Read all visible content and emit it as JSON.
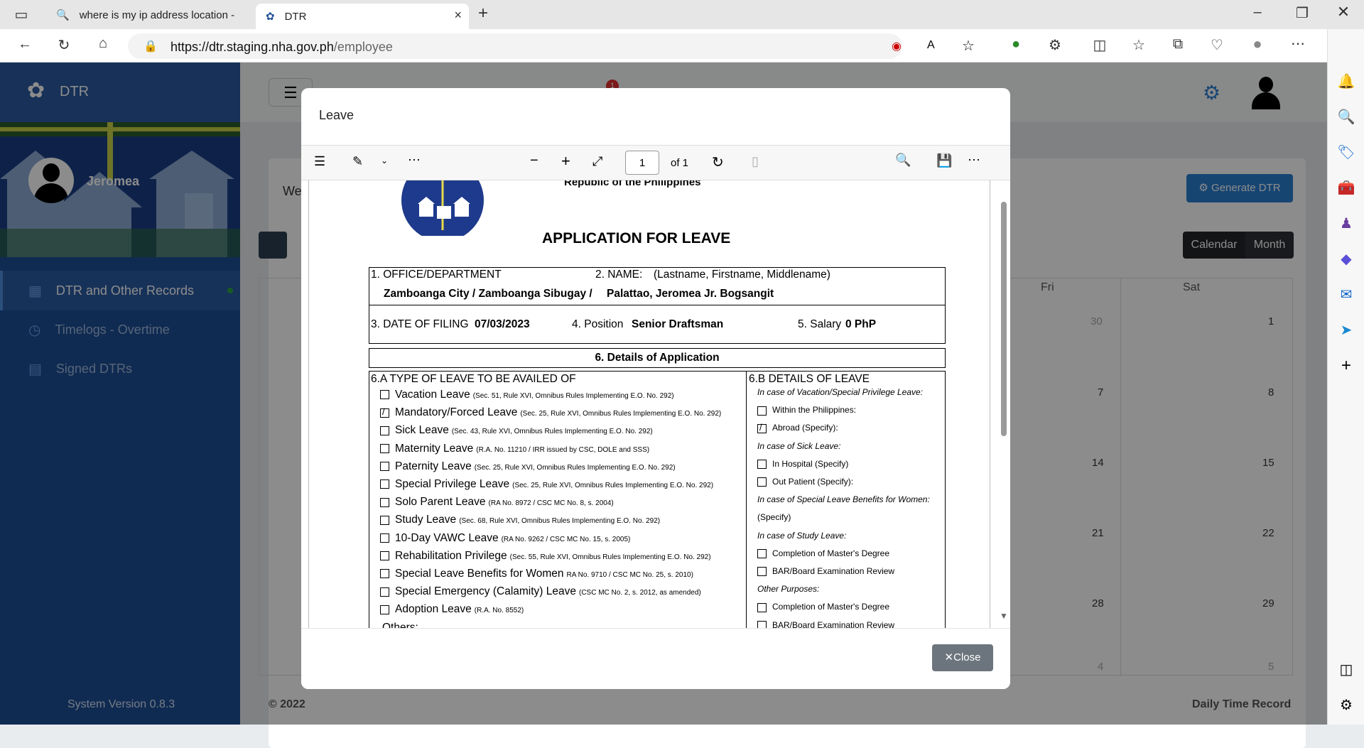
{
  "browser": {
    "tabs": [
      {
        "title": "where is my ip address location -"
      },
      {
        "title": "DTR"
      }
    ],
    "url_host": "https://dtr.staging.nha.gov.ph",
    "url_path": "/employee"
  },
  "app": {
    "brand": "DTR",
    "user_name": "Jeromea",
    "nav": [
      {
        "label": "DTR and Other Records",
        "active": true
      },
      {
        "label": "Timelogs - Overtime",
        "active": false
      },
      {
        "label": "Signed DTRs",
        "active": false
      }
    ],
    "system_version": "System Version 0.8.3",
    "notification_count": "1",
    "card_title_partial": "We",
    "generate_button": "Generate DTR",
    "view_buttons": [
      "Calendar",
      "Month"
    ],
    "weekdays_visible": [
      "Fri",
      "Sat"
    ],
    "calendar_days": [
      {
        "fri": "30",
        "sat": "1"
      },
      {
        "fri": "7",
        "sat": "8"
      },
      {
        "fri": "14",
        "sat": "15"
      },
      {
        "fri": "21",
        "sat": "22"
      },
      {
        "fri": "28",
        "sat": "29"
      },
      {
        "fri": "4",
        "sat": "5"
      }
    ],
    "footer_left": "© 2022",
    "footer_right": "Daily Time Record"
  },
  "modal": {
    "title": "Leave",
    "close_label": "Close",
    "pdf_toolbar": {
      "page": "1",
      "page_total": "of 1"
    },
    "form": {
      "republic": "Republic of the Philippines",
      "heading": "APPLICATION FOR LEAVE",
      "office_label": "1. OFFICE/DEPARTMENT",
      "name_label": "2. NAME:",
      "name_hint": "(Lastname, Firstname, Middlename)",
      "office_value": "Zamboanga City / Zamboanga Sibugay /",
      "name_value": "Palattao, Jeromea Jr. Bogsangit",
      "date_label": "3. DATE OF FILING",
      "date_value": "07/03/2023",
      "position_label": "4. Position",
      "position_value": "Senior Draftsman",
      "salary_label": "5. Salary",
      "salary_value": "0 PhP",
      "details_heading": "6. Details of Application",
      "type_heading": "6.A TYPE OF LEAVE TO BE AVAILED OF",
      "details_of_leave_heading": "6.B DETAILS OF LEAVE",
      "leave_types": [
        {
          "label": "Vacation Leave",
          "ref": "(Sec. 51, Rule XVI, Omnibus Rules Implementing E.O. No. 292)",
          "checked": false
        },
        {
          "label": "Mandatory/Forced Leave",
          "ref": "(Sec. 25, Rule XVI, Omnibus Rules Implementing E.O. No. 292)",
          "checked": true
        },
        {
          "label": "Sick Leave",
          "ref": "(Sec. 43, Rule XVI, Omnibus Rules Implementing E.O. No. 292)",
          "checked": false
        },
        {
          "label": "Maternity Leave",
          "ref": "(R.A. No. 11210 / IRR issued by CSC, DOLE and SSS)",
          "checked": false
        },
        {
          "label": "Paternity Leave",
          "ref": "(Sec. 25, Rule XVI, Omnibus Rules Implementing E.O. No. 292)",
          "checked": false
        },
        {
          "label": "Special Privilege Leave",
          "ref": "(Sec. 25, Rule XVI, Omnibus Rules Implementing E.O. No. 292)",
          "checked": false
        },
        {
          "label": "Solo Parent Leave",
          "ref": "(RA No. 8972 / CSC MC No. 8, s. 2004)",
          "checked": false
        },
        {
          "label": "Study Leave",
          "ref": "(Sec. 68, Rule XVI, Omnibus Rules Implementing E.O. No. 292)",
          "checked": false
        },
        {
          "label": "10-Day VAWC Leave",
          "ref": "(RA No. 9262 / CSC MC No. 15, s. 2005)",
          "checked": false
        },
        {
          "label": "Rehabilitation Privilege",
          "ref": "(Sec. 55, Rule XVI, Omnibus Rules Implementing E.O. No. 292)",
          "checked": false
        },
        {
          "label": "Special Leave Benefits for Women",
          "ref": "RA No. 9710 / CSC MC No. 25, s. 2010)",
          "checked": false
        },
        {
          "label": "Special Emergency (Calamity) Leave",
          "ref": "(CSC MC No. 2, s. 2012, as amended)",
          "checked": false
        },
        {
          "label": "Adoption Leave",
          "ref": "(R.A. No. 8552)",
          "checked": false
        }
      ],
      "others_label": "Others:",
      "details_items": [
        {
          "text": "In case of Vacation/Special Privilege Leave:",
          "italic": true,
          "box": false,
          "checked": false
        },
        {
          "text": "Within the Philippines:",
          "italic": false,
          "box": true,
          "checked": false
        },
        {
          "text": "Abroad (Specify):",
          "italic": false,
          "box": true,
          "checked": true
        },
        {
          "text": "In case of Sick Leave:",
          "italic": true,
          "box": false,
          "checked": false
        },
        {
          "text": "In Hospital (Specify)",
          "italic": false,
          "box": true,
          "checked": false
        },
        {
          "text": "Out Patient (Specify):",
          "italic": false,
          "box": true,
          "checked": false
        },
        {
          "text": "In case of Special Leave Benefits for Women:",
          "italic": true,
          "box": false,
          "checked": false
        },
        {
          "text": "(Specify)",
          "italic": false,
          "box": false,
          "checked": false
        },
        {
          "text": "In case of Study Leave:",
          "italic": true,
          "box": false,
          "checked": false
        },
        {
          "text": "Completion of Master's Degree",
          "italic": false,
          "box": true,
          "checked": false
        },
        {
          "text": "BAR/Board Examination Review",
          "italic": false,
          "box": true,
          "checked": false
        },
        {
          "text": "Other Purposes:",
          "italic": true,
          "box": false,
          "checked": false
        },
        {
          "text": "Completion of Master's Degree",
          "italic": false,
          "box": true,
          "checked": false
        },
        {
          "text": "BAR/Board Examination Review",
          "italic": false,
          "box": true,
          "checked": false
        }
      ]
    }
  },
  "colors": {
    "sidebar": "#1e4f95",
    "primary": "#2b7fd0",
    "dark_button": "#212529",
    "close_button": "#6c757d"
  }
}
